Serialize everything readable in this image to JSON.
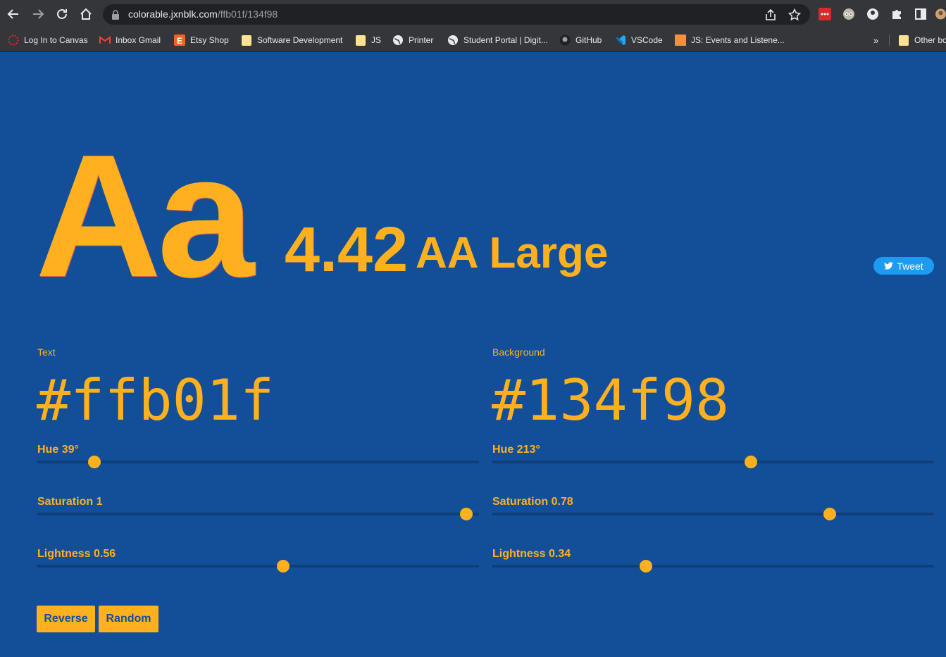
{
  "browser": {
    "url_host": "colorable.jxnblk.com",
    "url_path": "/ffb01f/134f98",
    "bookmarks": [
      {
        "label": "Log In to Canvas",
        "icon": "canvas-icon"
      },
      {
        "label": "Inbox Gmail",
        "icon": "gmail-icon"
      },
      {
        "label": "Etsy Shop",
        "icon": "etsy-icon"
      },
      {
        "label": "Software Development",
        "icon": "folder-icon"
      },
      {
        "label": "JS",
        "icon": "folder-icon"
      },
      {
        "label": "Printer",
        "icon": "globe-icon"
      },
      {
        "label": "Student Portal | Digit...",
        "icon": "globe-icon"
      },
      {
        "label": "GitHub",
        "icon": "github-icon"
      },
      {
        "label": "VSCode",
        "icon": "vscode-icon"
      },
      {
        "label": "JS: Events and Listene...",
        "icon": "page-icon"
      }
    ],
    "more_label": "»",
    "other_label": "Other bo"
  },
  "hero": {
    "sample": "Aa",
    "ratio": "4.42",
    "score": "AA Large",
    "tweet": "Tweet"
  },
  "text_panel": {
    "label": "Text",
    "hex": "#ffb01f",
    "hue_label": "Hue 39°",
    "hue_value": 39,
    "saturation_label": "Saturation 1",
    "saturation_value": 1,
    "lightness_label": "Lightness 0.56",
    "lightness_value": 0.56
  },
  "bg_panel": {
    "label": "Background",
    "hex": "#134f98",
    "hue_label": "Hue 213°",
    "hue_value": 213,
    "saturation_label": "Saturation 0.78",
    "saturation_value": 0.78,
    "lightness_label": "Lightness 0.34",
    "lightness_value": 0.34
  },
  "buttons": {
    "reverse": "Reverse",
    "random": "Random"
  },
  "colors": {
    "text": "#ffb01f",
    "background": "#134f98",
    "tweet": "#1d9bf0"
  }
}
